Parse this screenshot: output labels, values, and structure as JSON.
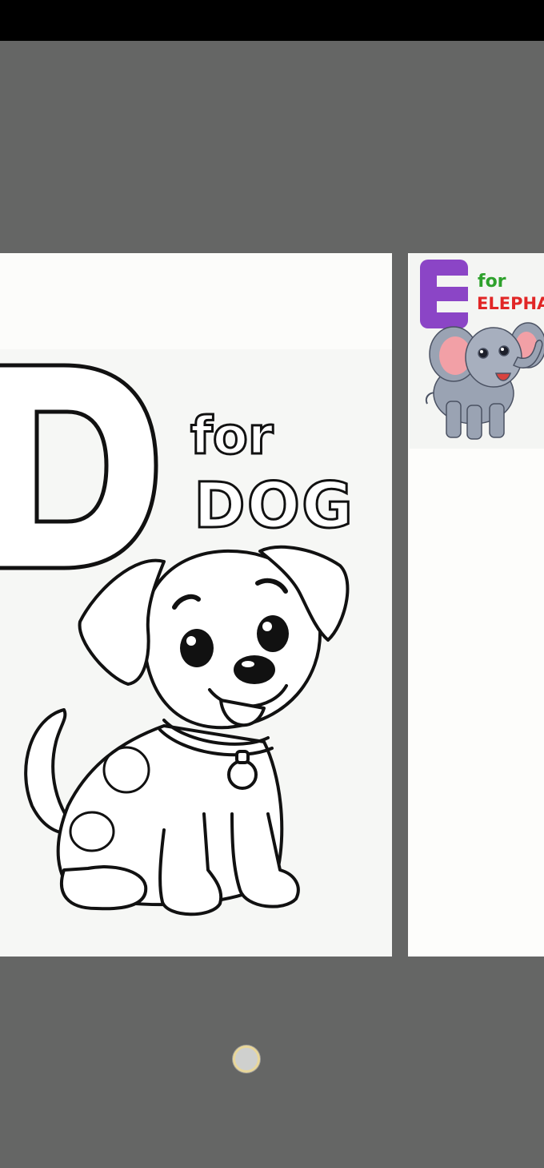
{
  "status_bar": {},
  "current_page": {
    "letter": "D",
    "for_text": "for",
    "word": "DOG"
  },
  "next_page": {
    "letter": "E",
    "for_text": "for",
    "word": "ELEPHAN",
    "colors": {
      "letter": "#8b45c6",
      "for": "#2ea12c",
      "word": "#e12626",
      "elephant_body": "#9aa3b3",
      "elephant_ear": "#f2a0a6"
    }
  },
  "page_indicator": {
    "icon": "dot-indicator-icon"
  }
}
